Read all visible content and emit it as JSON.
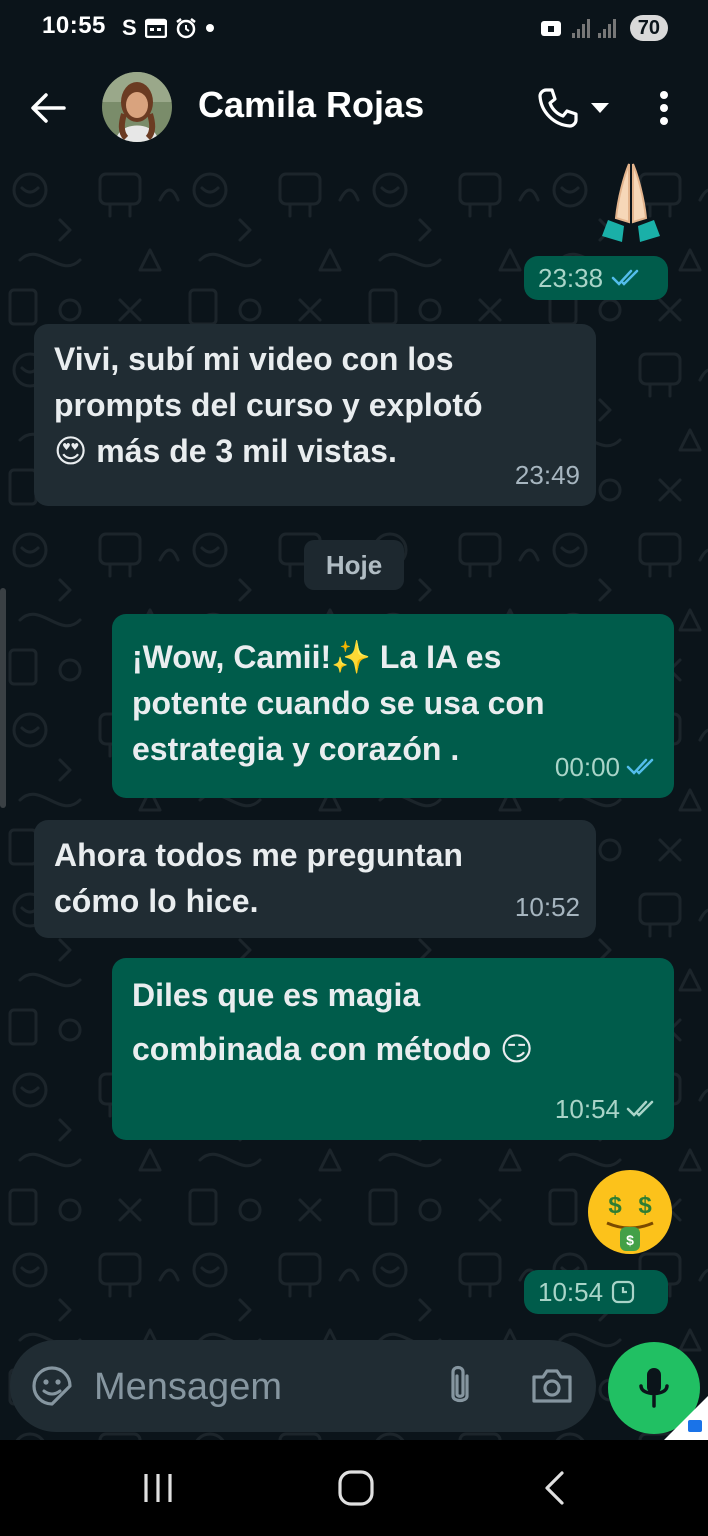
{
  "status_bar": {
    "time": "10:55",
    "battery": "70"
  },
  "header": {
    "contact_name": "Camila Rojas"
  },
  "chat": {
    "date_divider": "Hoje",
    "messages": [
      {
        "direction": "out",
        "emoji": "🙏🏼",
        "time": "23:38",
        "receipt": "read"
      },
      {
        "direction": "in",
        "text": "Vivi, subí mi video con los prompts del curso y explotó 😍 más de 3 mil vistas.",
        "lines": [
          "Vivi, subí mi video con los",
          "prompts del curso y explotó",
          "😍 más de 3 mil vistas."
        ],
        "time": "23:49"
      },
      {
        "direction": "out",
        "text": "¡Wow, Camii!✨ La IA es potente cuando se usa con estrategia y corazón .",
        "lines": [
          "¡Wow, Camii!✨ La IA es",
          "potente cuando se usa con",
          "estrategia y corazón ."
        ],
        "time": "00:00",
        "receipt": "read"
      },
      {
        "direction": "in",
        "text": "Ahora todos me preguntan cómo lo hice.",
        "lines": [
          "Ahora todos me preguntan",
          "cómo lo hice."
        ],
        "time": "10:52"
      },
      {
        "direction": "out",
        "text": "Diles que es magia combinada con método 😏",
        "lines": [
          "Diles que es magia",
          "combinada con método 😏"
        ],
        "time": "10:54",
        "receipt": "delivered"
      },
      {
        "direction": "out",
        "emoji": "🤑",
        "time": "10:54",
        "receipt": "pending"
      }
    ]
  },
  "composer": {
    "placeholder": "Mensagem"
  },
  "icons": {
    "back": "arrow-left-icon",
    "call": "phone-icon",
    "call_dropdown": "caret-down-icon",
    "menu": "kebab-menu-icon",
    "emoji": "sticker-icon",
    "attach": "paperclip-icon",
    "camera": "camera-icon",
    "mic": "microphone-icon",
    "read": "double-check-icon",
    "pending": "clock-icon",
    "nav_recents": "recents-icon",
    "nav_home": "home-icon",
    "nav_back": "nav-back-icon"
  },
  "colors": {
    "background": "#0b141a",
    "incoming_bubble": "#202c33",
    "outgoing_bubble": "#005c4b",
    "read_tick": "#53bdeb",
    "accent_green": "#21c063"
  }
}
